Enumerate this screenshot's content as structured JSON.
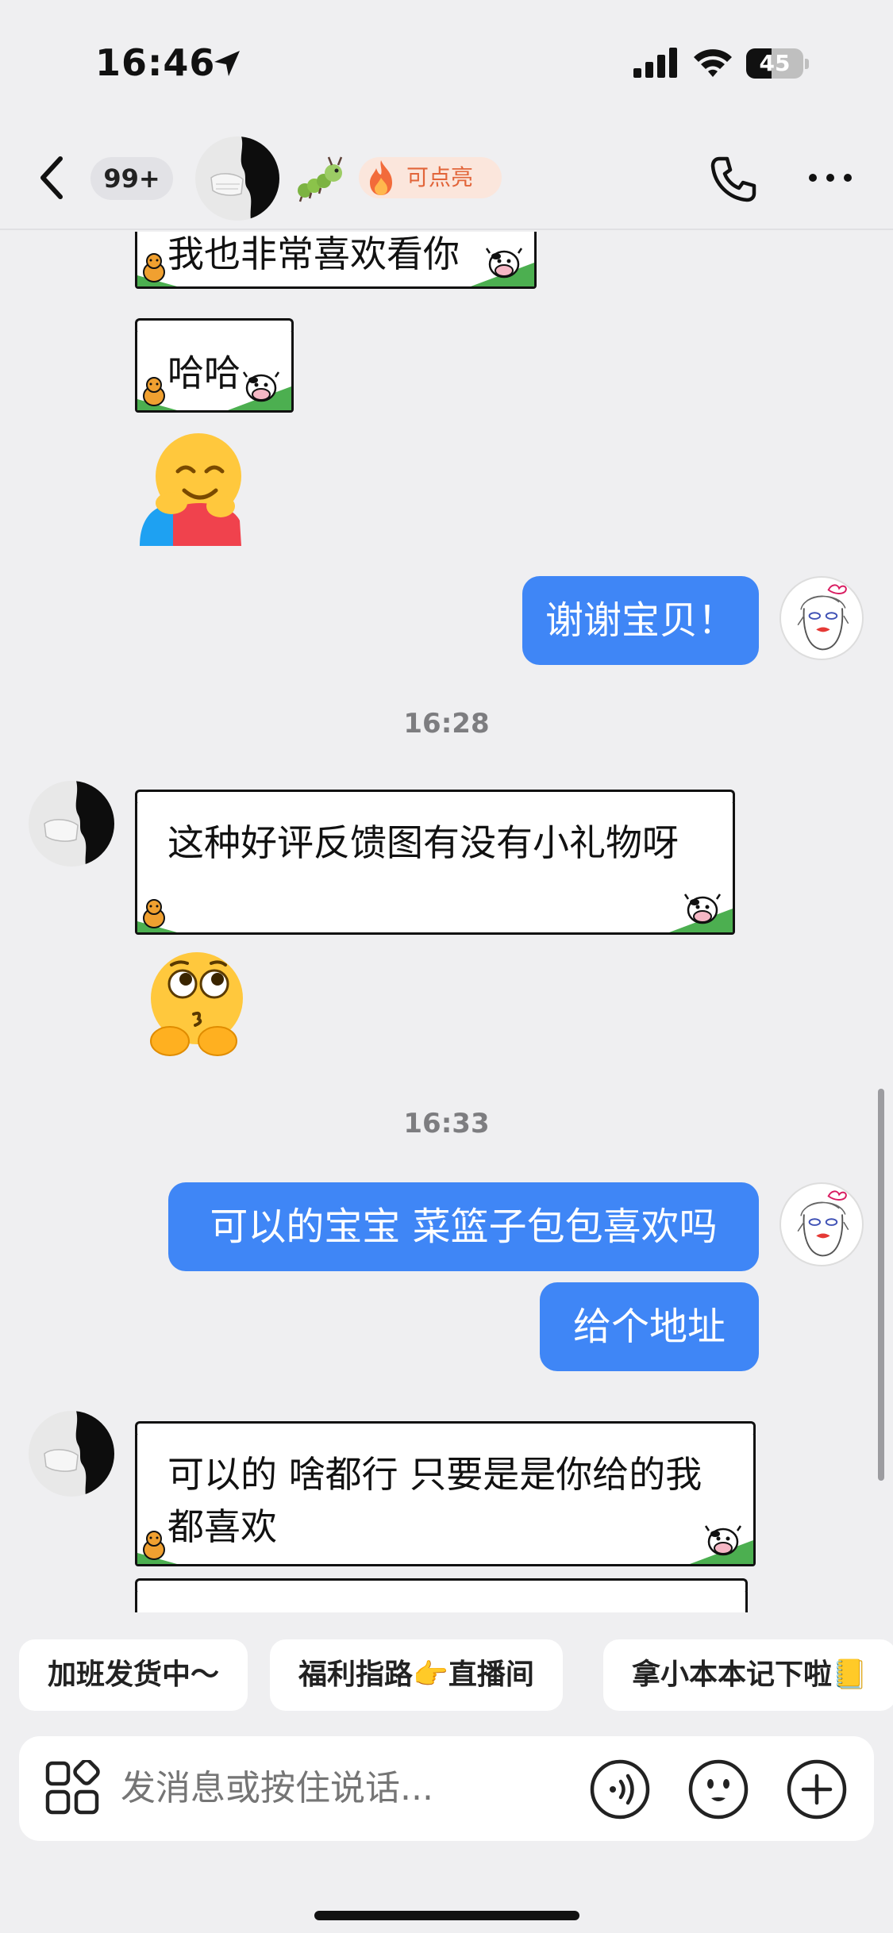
{
  "status_bar": {
    "time": "16:46",
    "battery": "45",
    "battery_fraction": 0.45
  },
  "nav": {
    "unread_count": "99+",
    "fire_label": "可点亮"
  },
  "messages": [
    {
      "side": "left",
      "kind": "box",
      "text": "我也非常喜欢看你"
    },
    {
      "side": "left",
      "kind": "box",
      "text": "哈哈"
    },
    {
      "side": "left",
      "kind": "emoji",
      "emoji": "hug-emoji"
    },
    {
      "side": "right",
      "kind": "bubble",
      "text": "谢谢宝贝！"
    },
    {
      "kind": "time",
      "text": "16:28"
    },
    {
      "side": "left",
      "kind": "box",
      "text": "这种好评反馈图有没有小礼物呀"
    },
    {
      "side": "left",
      "kind": "emoji",
      "emoji": "pleading-emoji"
    },
    {
      "kind": "time",
      "text": "16:33"
    },
    {
      "side": "right",
      "kind": "bubble",
      "text": "可以的宝宝 菜篮子包包喜欢吗"
    },
    {
      "side": "right",
      "kind": "bubble",
      "text": "给个地址"
    },
    {
      "side": "left",
      "kind": "box",
      "text": "可以的 啥都行 只要是是你给的我都喜欢"
    }
  ],
  "quick_replies": [
    "加班发货中～",
    "福利指路👉直播间",
    "拿小本本记下啦📒"
  ],
  "input": {
    "placeholder": "发消息或按住说话..."
  },
  "colors": {
    "blue_bubble": "#3f86f6",
    "background": "#efeff1",
    "fire_text": "#e2653a"
  }
}
